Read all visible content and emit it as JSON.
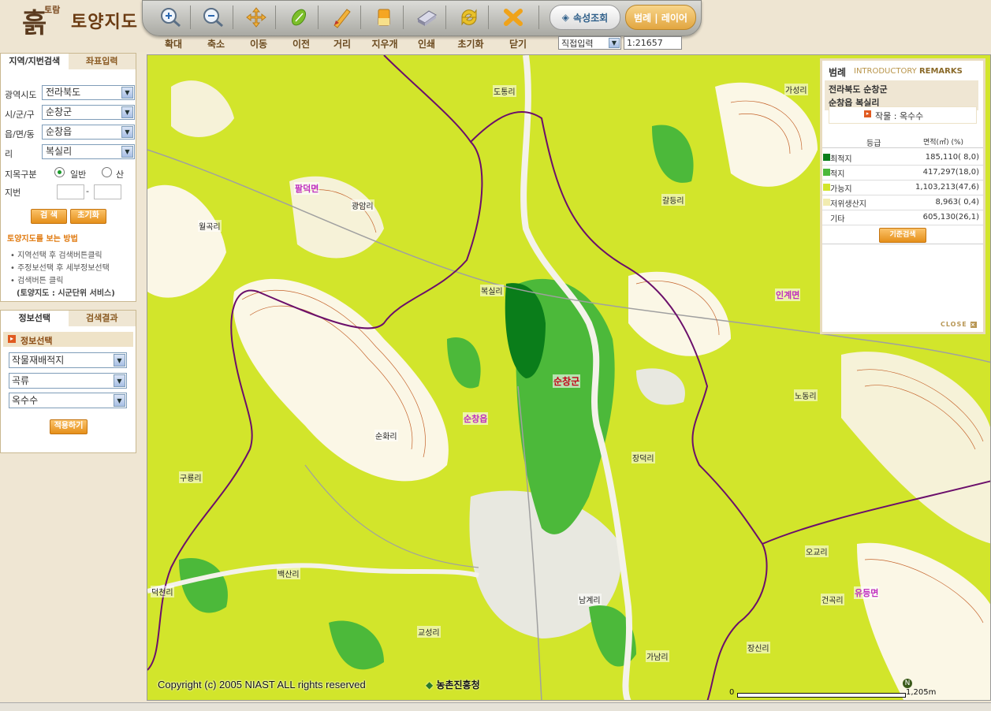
{
  "header": {
    "logo_mark": "흙",
    "logo_sub": "토람",
    "logo_title": "토양지도",
    "tools": [
      {
        "label": "확대",
        "icon": "zoom-in-icon"
      },
      {
        "label": "축소",
        "icon": "zoom-out-icon"
      },
      {
        "label": "이동",
        "icon": "move-icon"
      },
      {
        "label": "이전",
        "icon": "previous-icon"
      },
      {
        "label": "거리",
        "icon": "distance-icon"
      },
      {
        "label": "지우개",
        "icon": "eraser-icon"
      },
      {
        "label": "인쇄",
        "icon": "print-icon"
      },
      {
        "label": "초기화",
        "icon": "reset-icon"
      },
      {
        "label": "닫기",
        "icon": "close-icon"
      }
    ],
    "attr_button": "속성조회",
    "legend_button": "범례 | 레이어",
    "scale_mode": "직접입력",
    "scale_value": "1:21657"
  },
  "search_panel": {
    "tabs": [
      "지역/지번검색",
      "좌표입력"
    ],
    "province_label": "광역시도",
    "province_value": "전라북도",
    "county_label": "시/군/구",
    "county_value": "순창군",
    "town_label": "읍/면/동",
    "town_value": "순창읍",
    "ri_label": "리",
    "ri_value": "복실리",
    "landtype_label": "지목구분",
    "landtype_options": [
      "일반",
      "산"
    ],
    "lot_label": "지번",
    "lot_sep": "-",
    "search_button": "검 색",
    "reset_button": "초기화",
    "help_title": "토양지도를 보는 방법",
    "help_items": [
      "지역선택 후 검색버튼클릭",
      "주정보선택 후 세부정보선택",
      "검색버튼 클릭"
    ],
    "help_note": "(토양지도 : 시군단위 서비스)"
  },
  "info_panel": {
    "tabs": [
      "정보선택",
      "검색결과"
    ],
    "header": "정보선택",
    "select1": "작물재배적지",
    "select2": "곡류",
    "select3": "옥수수",
    "apply_button": "적용하기"
  },
  "map": {
    "labels": [
      {
        "name": "도통리",
        "kind": "village"
      },
      {
        "name": "가성리",
        "kind": "village"
      },
      {
        "name": "팔덕면",
        "kind": "district"
      },
      {
        "name": "광암리",
        "kind": "village"
      },
      {
        "name": "갈등리",
        "kind": "village"
      },
      {
        "name": "월곡리",
        "kind": "village"
      },
      {
        "name": "복실리",
        "kind": "village"
      },
      {
        "name": "인계면",
        "kind": "district"
      },
      {
        "name": "순창군",
        "kind": "county"
      },
      {
        "name": "순창읍",
        "kind": "district"
      },
      {
        "name": "순화리",
        "kind": "village"
      },
      {
        "name": "노동리",
        "kind": "village"
      },
      {
        "name": "장덕리",
        "kind": "village"
      },
      {
        "name": "구룡리",
        "kind": "village"
      },
      {
        "name": "백산리",
        "kind": "village"
      },
      {
        "name": "오교리",
        "kind": "village"
      },
      {
        "name": "덕천리",
        "kind": "village"
      },
      {
        "name": "유등면",
        "kind": "district"
      },
      {
        "name": "남계리",
        "kind": "village"
      },
      {
        "name": "건곡리",
        "kind": "village"
      },
      {
        "name": "교성리",
        "kind": "village"
      },
      {
        "name": "가남리",
        "kind": "village"
      },
      {
        "name": "장신리",
        "kind": "village"
      }
    ],
    "copyright": "Copyright (c) 2005 NIAST  ALL  rights  reserved",
    "agency": "농촌진흥청",
    "scale_start": "0",
    "scale_end": "1,205m"
  },
  "legend": {
    "title": "범례",
    "title_en_light": "INTRODUCTORY ",
    "title_en_bold": "REMARKS",
    "location_line1": "전라북도 순창군",
    "location_line2": "순창읍 복실리",
    "crop": "작물 : 옥수수",
    "col_grade": "등급",
    "col_area": "면적(㎡) (%)",
    "rows": [
      {
        "name": "최적지",
        "value": "185,110(  8,0)",
        "color": "#0a7d1a"
      },
      {
        "name": "적지",
        "value": "417,297(18,0)",
        "color": "#4cb93a"
      },
      {
        "name": "가능지",
        "value": "1,103,213(47,6)",
        "color": "#d2e52b"
      },
      {
        "name": "저위생산지",
        "value": "8,963(  0,4)",
        "color": "#f2ecb0"
      },
      {
        "name": "기타",
        "value": "605,130(26,1)",
        "color": "#ffffff"
      }
    ],
    "reference_button": "기준검색",
    "close": "CLOSE"
  },
  "colors": {
    "optimal": "#0a7d1a",
    "suitable": "#4cb93a",
    "possible": "#d2e52b",
    "low": "#f2ecb0",
    "boundary": "#6b0f6b",
    "accent": "#e89a2a"
  }
}
